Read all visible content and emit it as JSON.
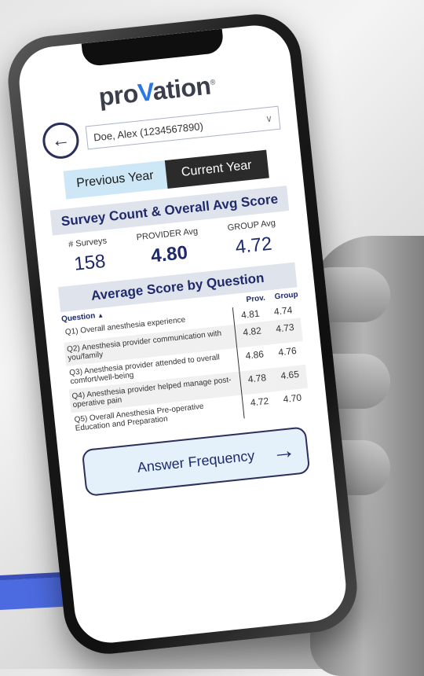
{
  "brand": {
    "logo_pre": "pro",
    "logo_v": "V",
    "logo_post": "ation"
  },
  "header": {
    "provider_select": "Doe, Alex (1234567890)"
  },
  "toggle": {
    "previous": "Previous Year",
    "current": "Current Year"
  },
  "summary": {
    "title": "Survey Count & Overall Avg Score",
    "surveys_label": "# Surveys",
    "surveys_value": "158",
    "provider_label": "PROVIDER Avg",
    "provider_value": "4.80",
    "group_label": "GROUP Avg",
    "group_value": "4.72"
  },
  "questions": {
    "title": "Average Score by Question",
    "col_question": "Question",
    "col_prov": "Prov.",
    "col_group": "Group",
    "rows": [
      {
        "q": "Q1) Overall anesthesia experience",
        "prov": "4.81",
        "group": "4.74"
      },
      {
        "q": "Q2) Anesthesia provider communication with you/family",
        "prov": "4.82",
        "group": "4.73"
      },
      {
        "q": "Q3) Anesthesia provider attended to overall comfort/well-being",
        "prov": "4.86",
        "group": "4.76"
      },
      {
        "q": "Q4) Anesthesia provider helped manage post-operative pain",
        "prov": "4.78",
        "group": "4.65"
      },
      {
        "q": "Q5) Overall Anesthesia Pre-operative Education and Preparation",
        "prov": "4.72",
        "group": "4.70"
      }
    ]
  },
  "actions": {
    "answer_frequency": "Answer Frequency"
  },
  "icons": {
    "back": "back-arrow-icon",
    "dropdown": "chevron-down-icon",
    "forward": "arrow-right-icon",
    "sort": "sort-up-icon"
  },
  "colors": {
    "brand_dark": "#1f2a6b",
    "accent_blue": "#2b78e4",
    "toggle_active": "#cde7f6",
    "band": "#dfe3ec"
  }
}
